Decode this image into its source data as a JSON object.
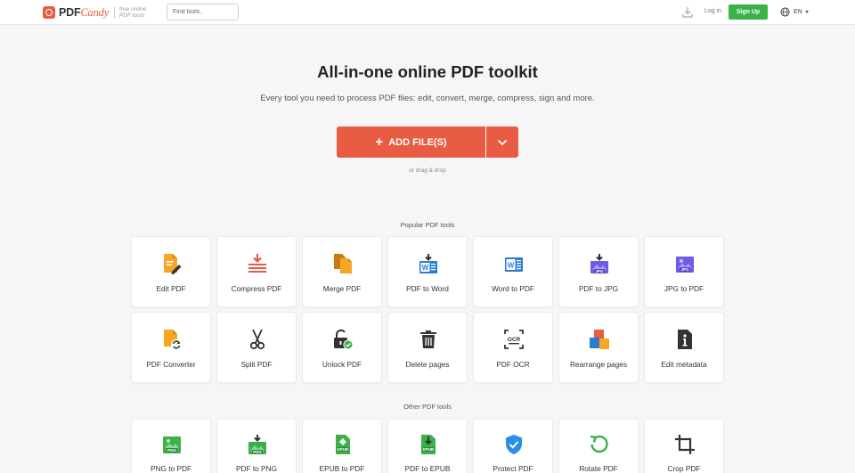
{
  "header": {
    "brand_pdf": "PDF",
    "brand_candy": "Candy",
    "tagline_line1": "free online",
    "tagline_line2": "PDF tools",
    "search_placeholder": "Find tools..",
    "login_label": "Log in",
    "signup_label": "Sign Up",
    "language": "EN"
  },
  "hero": {
    "title": "All-in-one online PDF toolkit",
    "subtitle": "Every tool you need to process PDF files: edit, convert, merge, compress, sign and more.",
    "add_files_label": "ADD FILE(S)",
    "drag_hint": "or drag & drop"
  },
  "sections": {
    "popular_title": "Popular PDF tools",
    "other_title": "Other PDF tools"
  },
  "popular_tools": [
    {
      "label": "Edit PDF",
      "icon": "edit-pdf-icon"
    },
    {
      "label": "Compress PDF",
      "icon": "compress-pdf-icon"
    },
    {
      "label": "Merge PDF",
      "icon": "merge-pdf-icon"
    },
    {
      "label": "PDF to Word",
      "icon": "pdf-to-word-icon"
    },
    {
      "label": "Word to PDF",
      "icon": "word-to-pdf-icon"
    },
    {
      "label": "PDF to JPG",
      "icon": "pdf-to-jpg-icon"
    },
    {
      "label": "JPG to PDF",
      "icon": "jpg-to-pdf-icon"
    },
    {
      "label": "PDF Converter",
      "icon": "pdf-converter-icon"
    },
    {
      "label": "Split PDF",
      "icon": "scissors-icon"
    },
    {
      "label": "Unlock PDF",
      "icon": "unlock-icon"
    },
    {
      "label": "Delete pages",
      "icon": "trash-icon"
    },
    {
      "label": "PDF OCR",
      "icon": "ocr-icon"
    },
    {
      "label": "Rearrange pages",
      "icon": "rearrange-icon"
    },
    {
      "label": "Edit metadata",
      "icon": "info-icon"
    }
  ],
  "other_tools": [
    {
      "label": "PNG to PDF",
      "icon": "png-to-pdf-icon"
    },
    {
      "label": "PDF to PNG",
      "icon": "pdf-to-png-icon"
    },
    {
      "label": "EPUB to PDF",
      "icon": "epub-to-pdf-icon"
    },
    {
      "label": "PDF to EPUB",
      "icon": "pdf-to-epub-icon"
    },
    {
      "label": "Protect PDF",
      "icon": "shield-icon"
    },
    {
      "label": "Rotate PDF",
      "icon": "rotate-icon"
    },
    {
      "label": "Crop PDF",
      "icon": "crop-icon"
    }
  ],
  "colors": {
    "accent": "#e85c44",
    "signup": "#3bb14a",
    "word_blue": "#2b7cd3",
    "jpg_purple": "#6c5ce7",
    "png_green": "#3bb14a",
    "orange": "#f5a623"
  }
}
